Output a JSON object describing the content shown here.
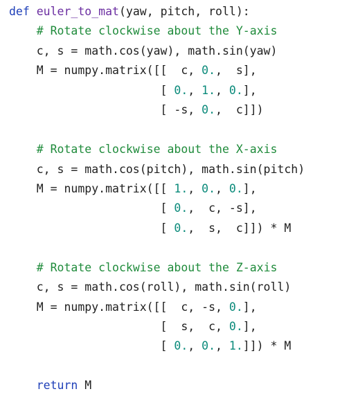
{
  "editor": {
    "colors": {
      "background": "#ffffff",
      "keyword": "#1e3fb8",
      "function_name": "#6b2ea1",
      "comment": "#1f8b3b",
      "number": "#0a8a7a",
      "text": "#1f1f1f"
    },
    "lines": [
      [
        {
          "t": "def",
          "k": "kw"
        },
        {
          "t": " "
        },
        {
          "t": "euler_to_mat",
          "k": "fn"
        },
        {
          "t": "(yaw, pitch, roll):"
        }
      ],
      [
        {
          "t": "    "
        },
        {
          "t": "# Rotate clockwise about the Y-axis",
          "k": "cm"
        }
      ],
      [
        {
          "t": "    c, s = math.cos(yaw), math.sin(yaw)"
        }
      ],
      [
        {
          "t": "    M = numpy.matrix([[  c, "
        },
        {
          "t": "0.",
          "k": "num"
        },
        {
          "t": ",  s],"
        }
      ],
      [
        {
          "t": "                      [ "
        },
        {
          "t": "0.",
          "k": "num"
        },
        {
          "t": ", "
        },
        {
          "t": "1.",
          "k": "num"
        },
        {
          "t": ", "
        },
        {
          "t": "0.",
          "k": "num"
        },
        {
          "t": "],"
        }
      ],
      [
        {
          "t": "                      [ -s, "
        },
        {
          "t": "0.",
          "k": "num"
        },
        {
          "t": ",  c]])"
        }
      ],
      [
        {
          "t": ""
        }
      ],
      [
        {
          "t": "    "
        },
        {
          "t": "# Rotate clockwise about the X-axis",
          "k": "cm"
        }
      ],
      [
        {
          "t": "    c, s = math.cos(pitch), math.sin(pitch)"
        }
      ],
      [
        {
          "t": "    M = numpy.matrix([[ "
        },
        {
          "t": "1.",
          "k": "num"
        },
        {
          "t": ", "
        },
        {
          "t": "0.",
          "k": "num"
        },
        {
          "t": ", "
        },
        {
          "t": "0.",
          "k": "num"
        },
        {
          "t": "],"
        }
      ],
      [
        {
          "t": "                      [ "
        },
        {
          "t": "0.",
          "k": "num"
        },
        {
          "t": ",  c, -s],"
        }
      ],
      [
        {
          "t": "                      [ "
        },
        {
          "t": "0.",
          "k": "num"
        },
        {
          "t": ",  s,  c]]) * M"
        }
      ],
      [
        {
          "t": ""
        }
      ],
      [
        {
          "t": "    "
        },
        {
          "t": "# Rotate clockwise about the Z-axis",
          "k": "cm"
        }
      ],
      [
        {
          "t": "    c, s = math.cos(roll), math.sin(roll)"
        }
      ],
      [
        {
          "t": "    M = numpy.matrix([[  c, -s, "
        },
        {
          "t": "0.",
          "k": "num"
        },
        {
          "t": "],"
        }
      ],
      [
        {
          "t": "                      [  s,  c, "
        },
        {
          "t": "0.",
          "k": "num"
        },
        {
          "t": "],"
        }
      ],
      [
        {
          "t": "                      [ "
        },
        {
          "t": "0.",
          "k": "num"
        },
        {
          "t": ", "
        },
        {
          "t": "0.",
          "k": "num"
        },
        {
          "t": ", "
        },
        {
          "t": "1.",
          "k": "num"
        },
        {
          "t": "]]) * M"
        }
      ],
      [
        {
          "t": ""
        }
      ],
      [
        {
          "t": "    "
        },
        {
          "t": "return",
          "k": "kw"
        },
        {
          "t": " M"
        }
      ]
    ]
  }
}
